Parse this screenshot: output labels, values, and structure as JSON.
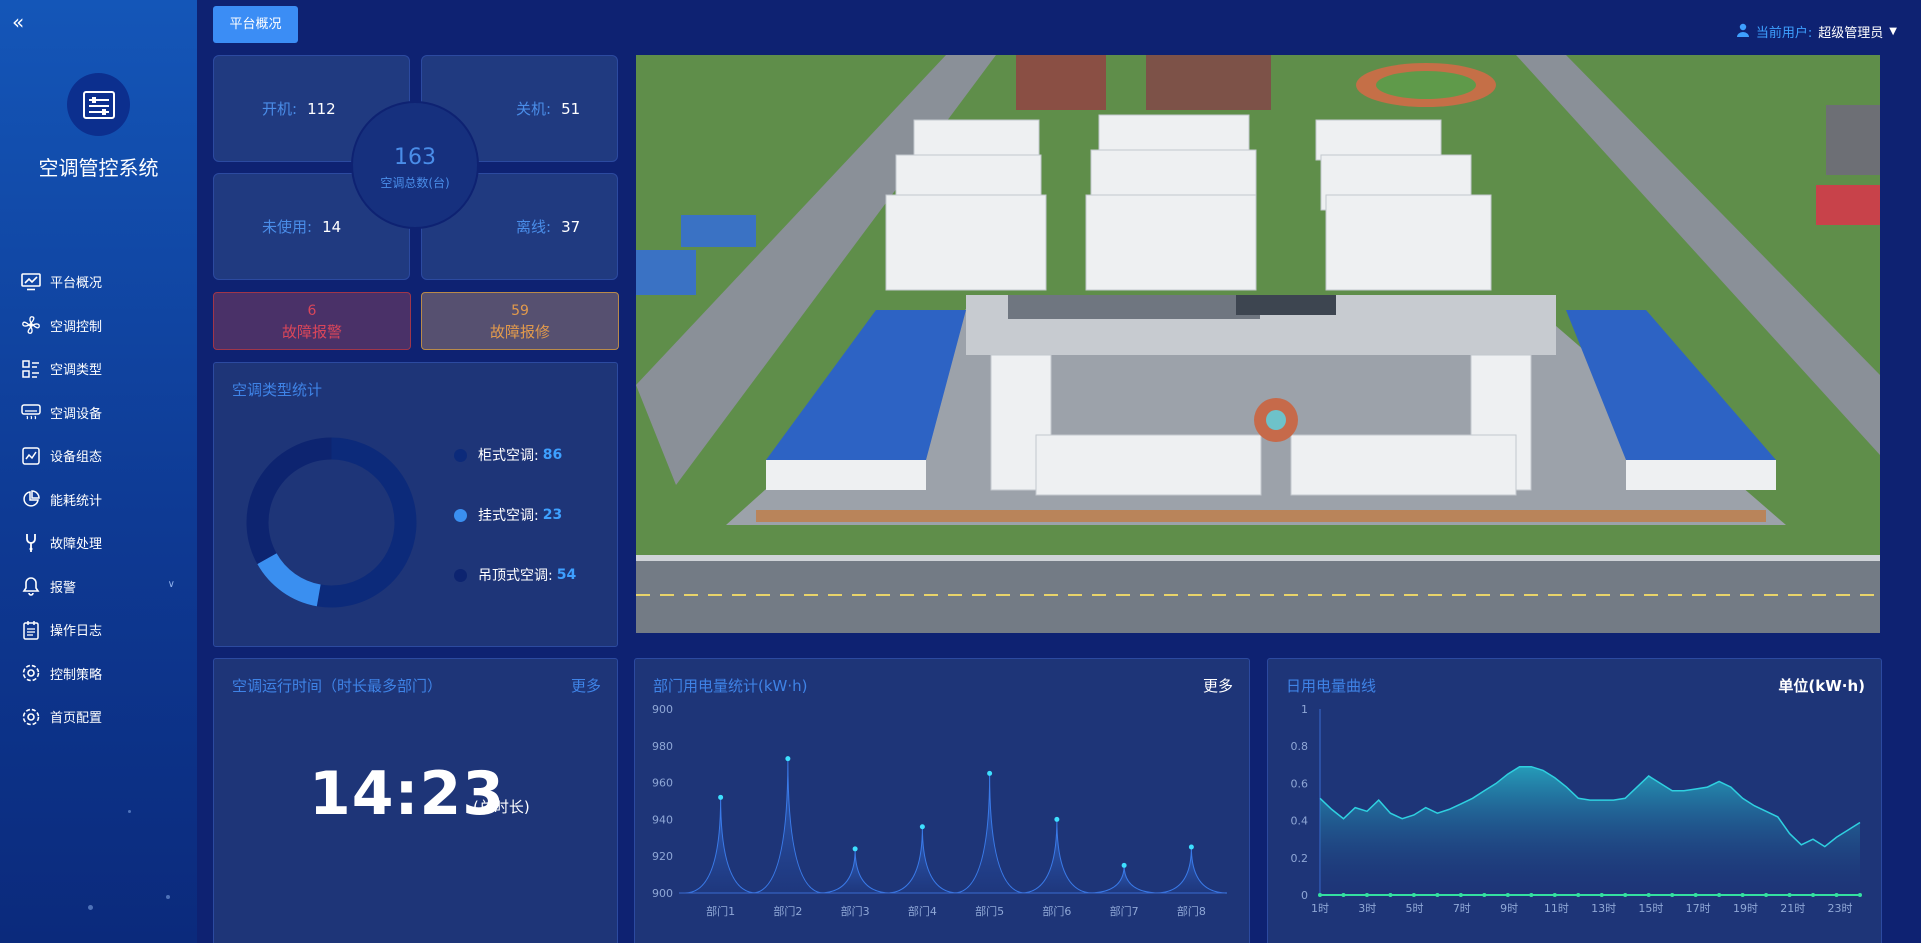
{
  "app": {
    "title": "空调管控系统"
  },
  "nav": [
    {
      "label": "平台概况",
      "icon": "monitor-chart-icon"
    },
    {
      "label": "空调控制",
      "icon": "fan-icon"
    },
    {
      "label": "空调类型",
      "icon": "list-icon"
    },
    {
      "label": "空调设备",
      "icon": "air-conditioner-icon"
    },
    {
      "label": "设备组态",
      "icon": "trend-chart-icon"
    },
    {
      "label": "能耗统计",
      "icon": "pie-chart-icon"
    },
    {
      "label": "故障处理",
      "icon": "wrench-icon"
    },
    {
      "label": "报警",
      "icon": "bell-icon",
      "has_caret": true
    },
    {
      "label": "操作日志",
      "icon": "log-icon"
    },
    {
      "label": "控制策略",
      "icon": "gear-icon"
    },
    {
      "label": "首页配置",
      "icon": "gear-icon"
    }
  ],
  "tabs": {
    "active": "平台概况"
  },
  "user": {
    "label": "当前用户:",
    "name": "超级管理员"
  },
  "status": {
    "on_label": "开机:",
    "on_value": "112",
    "off_label": "关机:",
    "off_value": "51",
    "unused_label": "未使用:",
    "unused_value": "14",
    "offline_label": "离线:",
    "offline_value": "37",
    "total_value": "163",
    "total_label": "空调总数(台)"
  },
  "alarms": {
    "fault_alarm_count": "6",
    "fault_alarm_label": "故障报警",
    "fault_repair_count": "59",
    "fault_repair_label": "故障报修"
  },
  "type_stats": {
    "title": "空调类型统计",
    "items": [
      {
        "label": "柜式空调:",
        "value": 86,
        "color": "#0c2a7a"
      },
      {
        "label": "挂式空调:",
        "value": 23,
        "color": "#3a8ff0"
      },
      {
        "label": "吊顶式空调:",
        "value": 54,
        "color": "#0d2470"
      }
    ]
  },
  "runtime": {
    "title": "空调运行时间（时长最多部门）",
    "more": "更多",
    "time": "14:23",
    "suffix": "(总时长)"
  },
  "dept_power": {
    "title": "部门用电量统计(kW·h)",
    "more": "更多"
  },
  "daily_power": {
    "title": "日用电量曲线",
    "unit": "单位(kW·h)"
  },
  "chart_data": [
    {
      "type": "area",
      "title": "部门用电量统计(kW·h)",
      "categories": [
        "部门1",
        "部门2",
        "部门3",
        "部门4",
        "部门5",
        "部门6",
        "部门7",
        "部门8"
      ],
      "values": [
        952,
        973,
        924,
        936,
        965,
        940,
        915,
        925
      ],
      "ylim": [
        900,
        1000
      ],
      "yticks": [
        "900",
        "920",
        "940",
        "960",
        "980",
        "900"
      ]
    },
    {
      "type": "line",
      "title": "日用电量曲线",
      "xlabel_ticks": [
        "1时",
        "3时",
        "5时",
        "7时",
        "9时",
        "11时",
        "13时",
        "15时",
        "17时",
        "19时",
        "21时",
        "23时"
      ],
      "yticks": [
        "0",
        "0.2",
        "0.4",
        "0.6",
        "0.8",
        "1"
      ],
      "ylim": [
        0,
        1
      ],
      "series": [
        {
          "values": [
            0.52,
            0.46,
            0.41,
            0.47,
            0.45,
            0.51,
            0.44,
            0.41,
            0.43,
            0.47,
            0.44,
            0.46,
            0.49,
            0.52,
            0.56,
            0.6,
            0.65,
            0.69,
            0.69,
            0.67,
            0.63,
            0.58,
            0.52,
            0.51,
            0.51,
            0.51,
            0.52,
            0.58,
            0.64,
            0.6,
            0.56,
            0.56,
            0.57,
            0.58,
            0.61,
            0.58,
            0.52,
            0.48,
            0.45,
            0.42,
            0.33,
            0.27,
            0.3,
            0.26,
            0.31,
            0.35,
            0.39
          ]
        },
        {
          "values": [
            0,
            0,
            0,
            0,
            0,
            0,
            0,
            0,
            0,
            0,
            0,
            0,
            0,
            0,
            0,
            0,
            0,
            0,
            0,
            0,
            0,
            0,
            0,
            0
          ]
        }
      ]
    }
  ]
}
